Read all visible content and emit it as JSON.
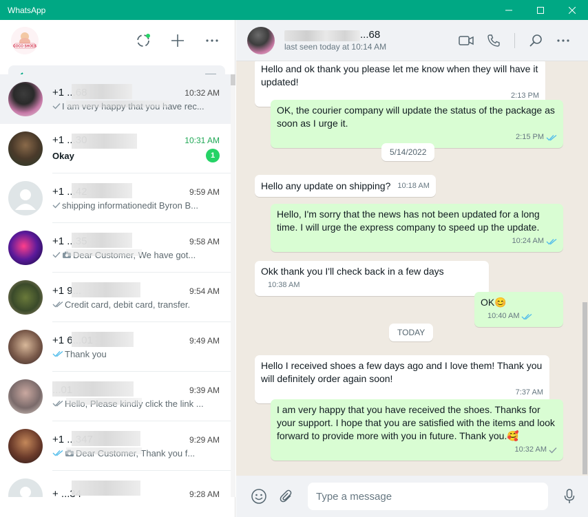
{
  "app": {
    "title": "WhatsApp"
  },
  "colors": {
    "accent": "#00a884",
    "outgoing_bubble": "#d9fdd3",
    "incoming_bubble": "#ffffff",
    "unread_badge": "#25d366",
    "read_ticks": "#53bdeb"
  },
  "sidebar": {
    "brand_text": "COCO SHOES",
    "header_icons": [
      "status-icon",
      "new-chat-icon",
      "more-options-icon"
    ],
    "search": {
      "icons": [
        "back-arrow-icon",
        "filter-icon"
      ]
    },
    "chats": [
      {
        "name": "+1 ...68",
        "time": "10:32 AM",
        "preview": "I am very happy that you have rec...",
        "ticks": "sent",
        "unread": ""
      },
      {
        "name": "+1 ...30",
        "time": "10:31 AM",
        "preview": "Okay",
        "ticks": "none",
        "unread": "1"
      },
      {
        "name": "+1 ...42",
        "time": "9:59 AM",
        "preview": "shipping informationedit Byron B...",
        "ticks": "sent",
        "unread": ""
      },
      {
        "name": "+1 ...35",
        "time": "9:58 AM",
        "preview": "Dear Customer,   We have got...",
        "ticks": "sent",
        "unread": ""
      },
      {
        "name": "+1 9...",
        "time": "9:54 AM",
        "preview": "Credit card, debit card, transfer.",
        "ticks": "delivered",
        "unread": ""
      },
      {
        "name": "+1 6...01",
        "time": "9:49 AM",
        "preview": "Thank you",
        "ticks": "read",
        "unread": ""
      },
      {
        "name": "...01",
        "time": "9:39 AM",
        "preview": "Hello, Please kindly click the link ...",
        "ticks": "delivered",
        "unread": ""
      },
      {
        "name": "+1 ...347",
        "time": "9:29 AM",
        "preview": "Dear Customer,   Thank you f...",
        "ticks": "read",
        "unread": ""
      },
      {
        "name": "+ ...34",
        "time": "9:28 AM",
        "preview": "",
        "ticks": "none",
        "unread": ""
      }
    ]
  },
  "conversation": {
    "contact_name": "...68",
    "status": "last seen today at 10:14 AM",
    "header_icons": [
      "video-call-icon",
      "voice-call-icon",
      "search-icon",
      "more-options-icon"
    ],
    "messages": [
      {
        "dir": "in",
        "text": "Hello and ok thank you please let me know when they will have it updated!",
        "time": "2:13 PM",
        "ticks": ""
      },
      {
        "dir": "out",
        "text": "OK, the courier company will update the status of the package as soon as I urge it.",
        "time": "2:15 PM",
        "ticks": "read"
      },
      {
        "dir": "date",
        "text": "5/14/2022"
      },
      {
        "dir": "in",
        "text": "Hello any update on shipping?",
        "time": "10:18 AM",
        "ticks": ""
      },
      {
        "dir": "out",
        "text": "Hello, I'm sorry that the news has not been updated for a long time. I will urge the express company to speed up the update.",
        "time": "10:24 AM",
        "ticks": "read"
      },
      {
        "dir": "in",
        "text": "Okk thank you I'll check back in a few days",
        "time": "10:38 AM",
        "ticks": ""
      },
      {
        "dir": "out",
        "text": "OK😊",
        "time": "10:40 AM",
        "ticks": "read"
      },
      {
        "dir": "date",
        "text": "TODAY"
      },
      {
        "dir": "in",
        "text": "Hello I received shoes a few days ago and I love them! Thank you will definitely order again soon!",
        "time": "7:37 AM",
        "ticks": ""
      },
      {
        "dir": "out",
        "text": "I am very happy that you have received the shoes. Thanks for your support. I hope that you are satisfied with the items and look forward to provide more with you in future. Thank you.🥰",
        "time": "10:32 AM",
        "ticks": "sent"
      }
    ]
  },
  "composer": {
    "placeholder": "Type a message",
    "value": ""
  }
}
